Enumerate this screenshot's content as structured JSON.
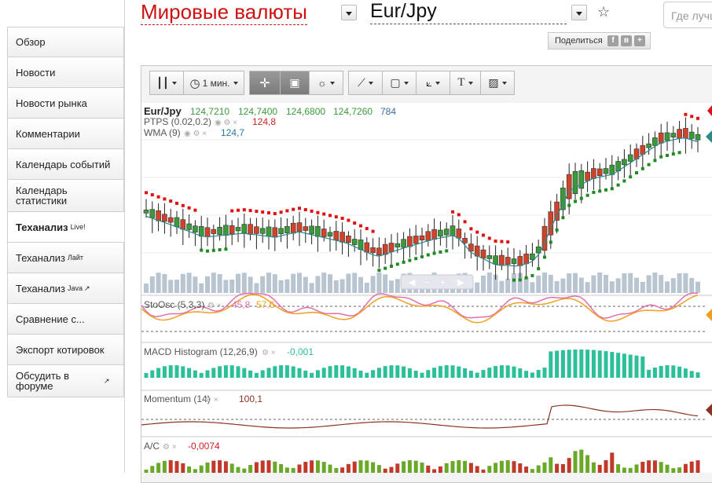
{
  "header": {
    "title": "Мировые валюты",
    "pair": "Eur/Jpy",
    "search_placeholder": "Где лучше",
    "share_label": "Поделиться",
    "share_icons": [
      "f",
      "в",
      "+"
    ]
  },
  "sidebar": {
    "items": [
      {
        "label": "Обзор"
      },
      {
        "label": "Новости"
      },
      {
        "label": "Новости рынка"
      },
      {
        "label": "Комментарии"
      },
      {
        "label": "Календарь событий"
      },
      {
        "label": "Календарь статистики"
      },
      {
        "label": "Теханализ",
        "sup": "Live!",
        "active": true
      },
      {
        "label": "Теханализ",
        "sup": "Лайт"
      },
      {
        "label": "Теханализ",
        "sup": "Java",
        "ext": "↗"
      },
      {
        "label": "Сравнение с..."
      },
      {
        "label": "Экспорт котировок"
      },
      {
        "label": "Обсудить в форуме",
        "ext": "↗"
      }
    ]
  },
  "toolbar": {
    "interval_label": "1 мин."
  },
  "chart": {
    "symbol": "Eur/Jpy",
    "open": "124,7210",
    "high": "124,7400",
    "low": "124,6800",
    "close": "124,7260",
    "volume": "784",
    "ptps_label": "PTPS (0.02,0.2)",
    "ptps_value": "124,8",
    "wma_label": "WMA (9)",
    "wma_value": "124,7",
    "sto_label": "StoOsc (5,3,3)",
    "sto_k": "45,8",
    "sto_d": "57,6",
    "macd_label": "MACD Histogram (12,26,9)",
    "macd_value": "-0,001",
    "mom_label": "Momentum (14)",
    "mom_value": "100,1",
    "ac_label": "A/C",
    "ac_value": "-0,0074",
    "colors": {
      "up": "#3a9a3a",
      "down": "#d0432a",
      "psar_up": "#1f8a1f",
      "psar_down": "#e01010",
      "wma": "#2a8a8a",
      "sto_k": "#e06fb0",
      "sto_d": "#f0a020",
      "macd": "#2bbf9a",
      "mom": "#8a3322",
      "volume": "#b8c4d0"
    }
  }
}
